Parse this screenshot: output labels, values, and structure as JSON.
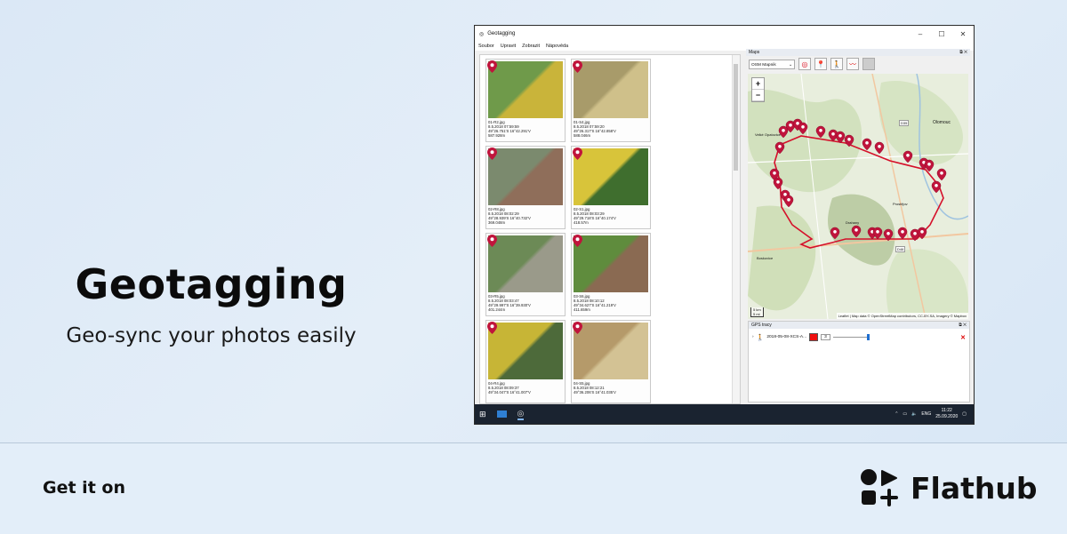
{
  "promo": {
    "title": "Geotagging",
    "subtitle": "Geo-sync your photos easily",
    "get_it_on": "Get it on",
    "store_name": "Flathub"
  },
  "app": {
    "window_title": "Geotagging",
    "menu": [
      "Soubor",
      "Upravit",
      "Zobrazit",
      "Nápověda"
    ],
    "photos": [
      {
        "file": "01-R2.jpg",
        "date": "8.5.2018 07:59:59",
        "coords": "49°26.751'S 16°42.291'V",
        "alt": "587.928m",
        "colors": [
          "#6f9a4a",
          "#c9b43a"
        ]
      },
      {
        "file": "01-S4.jpg",
        "date": "8.5.2018 07:59:20",
        "coords": "49°26.317'S 16°42.858'V",
        "alt": "588.046m",
        "colors": [
          "#a89b6a",
          "#cfc08a"
        ]
      },
      {
        "file": "02-R8.jpg",
        "date": "8.5.2018 08:02:29",
        "coords": "49°28.939'S 16°40.732'V",
        "alt": "369.048m",
        "colors": [
          "#7b8a6e",
          "#8f6e5a"
        ]
      },
      {
        "file": "02-S1.jpg",
        "date": "8.5.2018 08:03:29",
        "coords": "49°29.718'S 16°40.174'V",
        "alt": "418.57m",
        "colors": [
          "#d8c43a",
          "#3f6e2e"
        ]
      },
      {
        "file": "03-R5.jpg",
        "date": "8.5.2018 08:03:47",
        "coords": "49°29.997'S 16°39.930'V",
        "alt": "401.244m",
        "colors": [
          "#6c8a56",
          "#9a9a8a"
        ]
      },
      {
        "file": "03-S6.jpg",
        "date": "8.5.2018 08:10:12",
        "coords": "49°34.627'S 16°41.219'V",
        "alt": "411.659m",
        "colors": [
          "#5f8c3d",
          "#8a6a52"
        ]
      },
      {
        "file": "04-R4.jpg",
        "date": "8.5.2018 08:09:37",
        "coords": "49°34.047'S 16°41.007'V",
        "alt": "",
        "colors": [
          "#c7b536",
          "#4d6a3a"
        ]
      },
      {
        "file": "04-S5.jpg",
        "date": "8.5.2018 08:12:21",
        "coords": "49°36.206'S 16°41.035'V",
        "alt": "",
        "colors": [
          "#b59a6a",
          "#d3c294"
        ]
      }
    ],
    "maps_panel_title": "Maps",
    "map_source": "OSM Mapnik",
    "map_labels": [
      "Olomouc",
      "Prostějov",
      "Drahany",
      "Boskovice",
      "Velké Opatovice",
      "D35",
      "D46"
    ],
    "attribution": "Leaflet | Map data © OpenStreetMap contributors, CC-BY-SA, Imagery © Mapbox",
    "scale_top": "5 km",
    "scale_bottom": "5 mi",
    "gps_panel_title": "GPS tracy",
    "gps_track": {
      "name": "2018-05-08-XCS-A...",
      "width": "3"
    },
    "tray": {
      "lang": "ENG",
      "time": "11:22",
      "date": "25.09.2020"
    }
  }
}
